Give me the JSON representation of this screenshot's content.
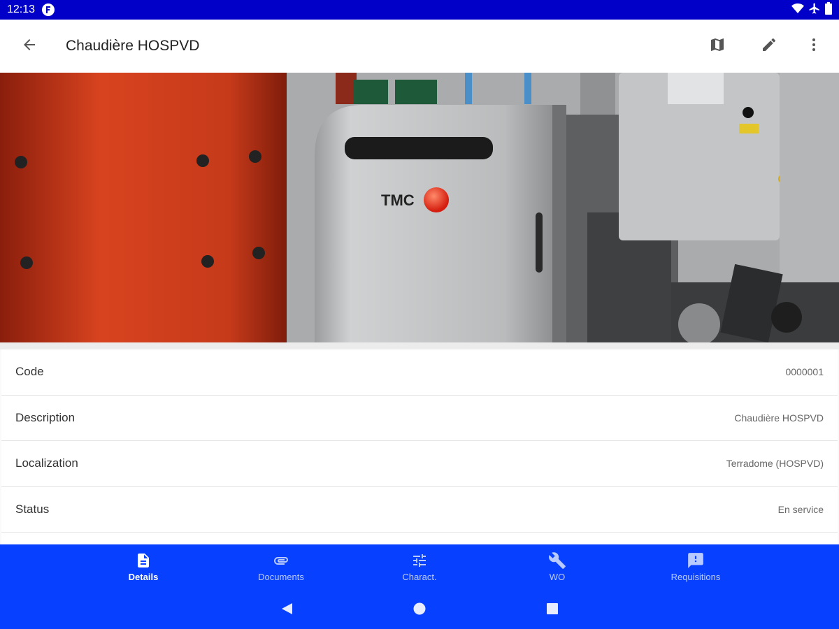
{
  "status_bar": {
    "time": "12:13",
    "notification_icon": "f-circle-icon",
    "icons": [
      "wifi-icon",
      "airplane-icon",
      "battery-icon"
    ]
  },
  "app_bar": {
    "title": "Chaudière HOSPVD",
    "back_icon": "arrow-back-icon",
    "actions": [
      "map-icon",
      "edit-icon",
      "more-vert-icon"
    ]
  },
  "hero": {
    "brand_text": "TMC"
  },
  "details": [
    {
      "label": "Code",
      "value": "0000001"
    },
    {
      "label": "Description",
      "value": "Chaudière HOSPVD"
    },
    {
      "label": "Localization",
      "value": "Terradome (HOSPVD)"
    },
    {
      "label": "Status",
      "value": "En service"
    }
  ],
  "tabs": [
    {
      "label": "Details",
      "icon": "document-icon",
      "active": true
    },
    {
      "label": "Documents",
      "icon": "attachment-icon",
      "active": false
    },
    {
      "label": "Charact.",
      "icon": "tune-icon",
      "active": false
    },
    {
      "label": "WO",
      "icon": "wrench-icon",
      "active": false
    },
    {
      "label": "Requisitions",
      "icon": "feedback-icon",
      "active": false
    }
  ],
  "system_nav": [
    "back-triangle-icon",
    "home-circle-icon",
    "recents-square-icon"
  ],
  "colors": {
    "status_bar": "#0000c8",
    "bottom_nav": "#0740ff",
    "app_bar": "#ffffff"
  }
}
